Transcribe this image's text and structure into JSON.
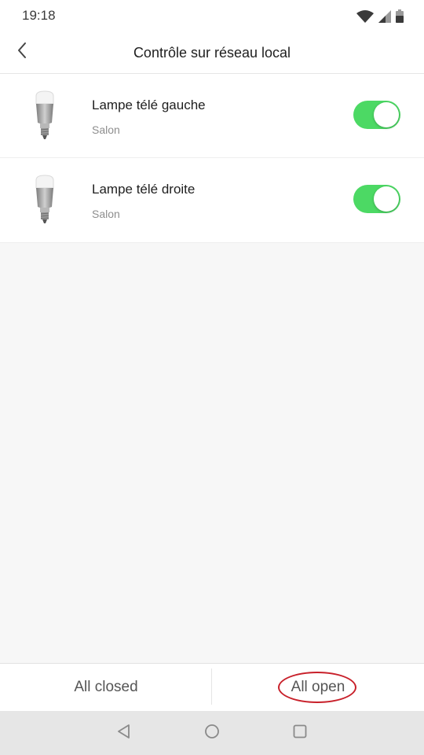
{
  "status_bar": {
    "time": "19:18",
    "icons": [
      "wifi-icon",
      "cell-signal-icon",
      "battery-icon"
    ]
  },
  "header": {
    "title": "Contrôle sur réseau local",
    "back_icon": "chevron-left-icon"
  },
  "devices": [
    {
      "name": "Lampe télé gauche",
      "room": "Salon",
      "icon": "light-bulb-icon",
      "enabled": true
    },
    {
      "name": "Lampe télé droite",
      "room": "Salon",
      "icon": "light-bulb-icon",
      "enabled": true
    }
  ],
  "bottom_actions": {
    "all_closed_label": "All closed",
    "all_open_label": "All open"
  },
  "nav_bar": {
    "icons": [
      "back-triangle-icon",
      "home-circle-icon",
      "recents-square-icon"
    ]
  },
  "colors": {
    "toggle_on": "#4cd964",
    "annotation": "#c8202a"
  }
}
